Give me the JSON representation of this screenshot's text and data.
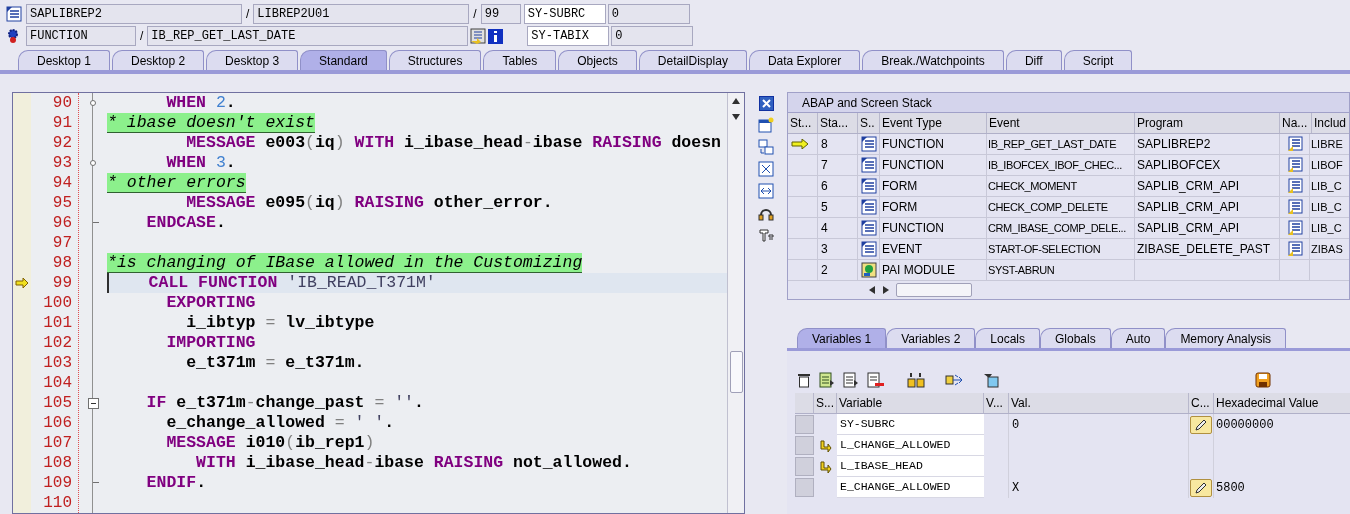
{
  "header": {
    "row1": {
      "program": "SAPLIBREP2",
      "include": "LIBREP2U01",
      "line": "99",
      "sysfield": "SY-SUBRC",
      "sysvalue": "0"
    },
    "row2": {
      "type": "FUNCTION",
      "name": "IB_REP_GET_LAST_DATE",
      "sysfield": "SY-TABIX",
      "sysvalue": "0"
    },
    "separator": "/"
  },
  "tabs": [
    {
      "label": "Desktop 1",
      "selected": false
    },
    {
      "label": "Desktop 2",
      "selected": false
    },
    {
      "label": "Desktop 3",
      "selected": false
    },
    {
      "label": "Standard",
      "selected": true
    },
    {
      "label": "Structures",
      "selected": false
    },
    {
      "label": "Tables",
      "selected": false
    },
    {
      "label": "Objects",
      "selected": false
    },
    {
      "label": "DetailDisplay",
      "selected": false
    },
    {
      "label": "Data Explorer",
      "selected": false
    },
    {
      "label": "Break./Watchpoints",
      "selected": false
    },
    {
      "label": "Diff",
      "selected": false
    },
    {
      "label": "Script",
      "selected": false
    }
  ],
  "code": [
    {
      "number": "90",
      "current": false,
      "kind": "node",
      "tokens": [
        {
          "kind": "kw",
          "text": "      WHEN "
        },
        {
          "kind": "num",
          "text": "2"
        },
        {
          "kind": "id",
          "text": "."
        }
      ]
    },
    {
      "number": "91",
      "current": false,
      "kind": "plain",
      "tokens": [
        {
          "kind": "cm",
          "text": "* ibase doesn't exist"
        }
      ]
    },
    {
      "number": "92",
      "current": false,
      "kind": "plain",
      "tokens": [
        {
          "kind": "kw",
          "text": "        MESSAGE"
        },
        {
          "kind": "id",
          "text": " e003"
        },
        {
          "kind": "op",
          "text": "("
        },
        {
          "kind": "id",
          "text": "iq"
        },
        {
          "kind": "op",
          "text": ") "
        },
        {
          "kind": "kw",
          "text": "WITH"
        },
        {
          "kind": "id",
          "text": " i_ibase_head"
        },
        {
          "kind": "op",
          "text": "-"
        },
        {
          "kind": "id",
          "text": "ibase "
        },
        {
          "kind": "kw",
          "text": "RAISING"
        },
        {
          "kind": "id",
          "text": " doesn"
        }
      ]
    },
    {
      "number": "93",
      "current": false,
      "kind": "node",
      "tokens": [
        {
          "kind": "kw",
          "text": "      WHEN "
        },
        {
          "kind": "num",
          "text": "3"
        },
        {
          "kind": "id",
          "text": "."
        }
      ]
    },
    {
      "number": "94",
      "current": false,
      "kind": "plain",
      "tokens": [
        {
          "kind": "cm",
          "text": "* other errors"
        }
      ]
    },
    {
      "number": "95",
      "current": false,
      "kind": "plain",
      "tokens": [
        {
          "kind": "kw",
          "text": "        MESSAGE"
        },
        {
          "kind": "id",
          "text": " e095"
        },
        {
          "kind": "op",
          "text": "("
        },
        {
          "kind": "id",
          "text": "iq"
        },
        {
          "kind": "op",
          "text": ") "
        },
        {
          "kind": "kw",
          "text": "RAISING"
        },
        {
          "kind": "id",
          "text": " other_error."
        }
      ]
    },
    {
      "number": "96",
      "current": false,
      "kind": "end",
      "tokens": [
        {
          "kind": "kw",
          "text": "    ENDCASE"
        },
        {
          "kind": "id",
          "text": "."
        }
      ]
    },
    {
      "number": "97",
      "current": false,
      "kind": "plain"
    },
    {
      "number": "98",
      "current": false,
      "kind": "plain",
      "tokens": [
        {
          "kind": "cm",
          "text": "*is changing of IBase allowed in the Customizing"
        }
      ]
    },
    {
      "number": "99",
      "current": true,
      "kind": "plain",
      "tokens": [
        {
          "kind": "kw",
          "text": "    CALL FUNCTION"
        },
        {
          "kind": "str",
          "text": " 'IB_READ_T371M'"
        }
      ]
    },
    {
      "number": "100",
      "current": false,
      "kind": "plain",
      "tokens": [
        {
          "kind": "kw",
          "text": "      EXPORTING"
        }
      ]
    },
    {
      "number": "101",
      "current": false,
      "kind": "plain",
      "tokens": [
        {
          "kind": "id",
          "text": "        i_ibtyp "
        },
        {
          "kind": "op",
          "text": "="
        },
        {
          "kind": "id",
          "text": " lv_ibtype"
        }
      ]
    },
    {
      "number": "102",
      "current": false,
      "kind": "plain",
      "tokens": [
        {
          "kind": "kw",
          "text": "      IMPORTING"
        }
      ]
    },
    {
      "number": "103",
      "current": false,
      "kind": "plain",
      "tokens": [
        {
          "kind": "id",
          "text": "        e_t371m "
        },
        {
          "kind": "op",
          "text": "="
        },
        {
          "kind": "id",
          "text": " e_t371m."
        }
      ]
    },
    {
      "number": "104",
      "current": false,
      "kind": "plain"
    },
    {
      "number": "105",
      "current": false,
      "kind": "box",
      "tokens": [
        {
          "kind": "kw",
          "text": "    IF"
        },
        {
          "kind": "id",
          "text": " e_t371m"
        },
        {
          "kind": "op",
          "text": "-"
        },
        {
          "kind": "id",
          "text": "change_past "
        },
        {
          "kind": "op",
          "text": "="
        },
        {
          "kind": "str",
          "text": " ''"
        },
        {
          "kind": "id",
          "text": "."
        }
      ]
    },
    {
      "number": "106",
      "current": false,
      "kind": "plain",
      "tokens": [
        {
          "kind": "id",
          "text": "      e_change_allowed "
        },
        {
          "kind": "op",
          "text": "="
        },
        {
          "kind": "str",
          "text": " ' '"
        },
        {
          "kind": "id",
          "text": "."
        }
      ]
    },
    {
      "number": "107",
      "current": false,
      "kind": "plain",
      "tokens": [
        {
          "kind": "kw",
          "text": "      MESSAGE"
        },
        {
          "kind": "id",
          "text": " i010"
        },
        {
          "kind": "op",
          "text": "("
        },
        {
          "kind": "id",
          "text": "ib_rep1"
        },
        {
          "kind": "op",
          "text": ")"
        }
      ]
    },
    {
      "number": "108",
      "current": false,
      "kind": "plain",
      "tokens": [
        {
          "kind": "kw",
          "text": "         WITH"
        },
        {
          "kind": "id",
          "text": " i_ibase_head"
        },
        {
          "kind": "op",
          "text": "-"
        },
        {
          "kind": "id",
          "text": "ibase "
        },
        {
          "kind": "kw",
          "text": "RAISING"
        },
        {
          "kind": "id",
          "text": " not_allowed."
        }
      ]
    },
    {
      "number": "109",
      "current": false,
      "kind": "end",
      "tokens": [
        {
          "kind": "kw",
          "text": "    ENDIF"
        },
        {
          "kind": "id",
          "text": "."
        }
      ]
    },
    {
      "number": "110",
      "current": false,
      "kind": "plain"
    }
  ],
  "stack": {
    "title": "ABAP and Screen Stack",
    "columns": [
      "St...",
      "Sta...",
      "S..",
      "Event Type",
      "Event",
      "Program",
      "Na...",
      "Includ"
    ],
    "rows": [
      {
        "current": true,
        "level": "8",
        "kind": "program",
        "event_type": "FUNCTION",
        "event": "IB_REP_GET_LAST_DATE",
        "program": "SAPLIBREP2",
        "nav": true,
        "include": "LIBRE"
      },
      {
        "current": false,
        "level": "7",
        "kind": "program",
        "event_type": "FUNCTION",
        "event": "IB_IBOFCEX_IBOF_CHEC...",
        "program": "SAPLIBOFCEX",
        "nav": true,
        "include": "LIBOF"
      },
      {
        "current": false,
        "level": "6",
        "kind": "program",
        "event_type": "FORM",
        "event": "CHECK_MOMENT",
        "program": "SAPLIB_CRM_API",
        "nav": true,
        "include": "LIB_C"
      },
      {
        "current": false,
        "level": "5",
        "kind": "program",
        "event_type": "FORM",
        "event": "CHECK_COMP_DELETE",
        "program": "SAPLIB_CRM_API",
        "nav": true,
        "include": "LIB_C"
      },
      {
        "current": false,
        "level": "4",
        "kind": "program",
        "event_type": "FUNCTION",
        "event": "CRM_IBASE_COMP_DELE...",
        "program": "SAPLIB_CRM_API",
        "nav": true,
        "include": "LIB_C"
      },
      {
        "current": false,
        "level": "3",
        "kind": "program",
        "event_type": "EVENT",
        "event": "START-OF-SELECTION",
        "program": "ZIBASE_DELETE_PAST",
        "nav": true,
        "include": "ZIBAS"
      },
      {
        "current": false,
        "level": "2",
        "kind": "screen",
        "event_type": "PAI MODULE",
        "event": "SYST-ABRUN",
        "nav": false
      }
    ]
  },
  "var_tabs": [
    {
      "label": "Variables 1",
      "selected": true
    },
    {
      "label": "Variables 2",
      "selected": false
    },
    {
      "label": "Locals",
      "selected": false
    },
    {
      "label": "Globals",
      "selected": false
    },
    {
      "label": "Auto",
      "selected": false
    },
    {
      "label": "Memory Analysis",
      "selected": false
    }
  ],
  "variables": {
    "columns": [
      "S...",
      "Variable",
      "V...",
      "Val.",
      "C...",
      "Hexadecimal Value"
    ],
    "rows": [
      {
        "reference": false,
        "name": "SY-SUBRC",
        "value": "0",
        "editable": true,
        "hex": "00000000"
      },
      {
        "reference": true,
        "name": "L_CHANGE_ALLOWED",
        "editable": false
      },
      {
        "reference": true,
        "name": "L_IBASE_HEAD",
        "editable": false
      },
      {
        "reference": false,
        "name": "E_CHANGE_ALLOWED",
        "value": "X",
        "editable": true,
        "hex": "5800"
      }
    ]
  }
}
